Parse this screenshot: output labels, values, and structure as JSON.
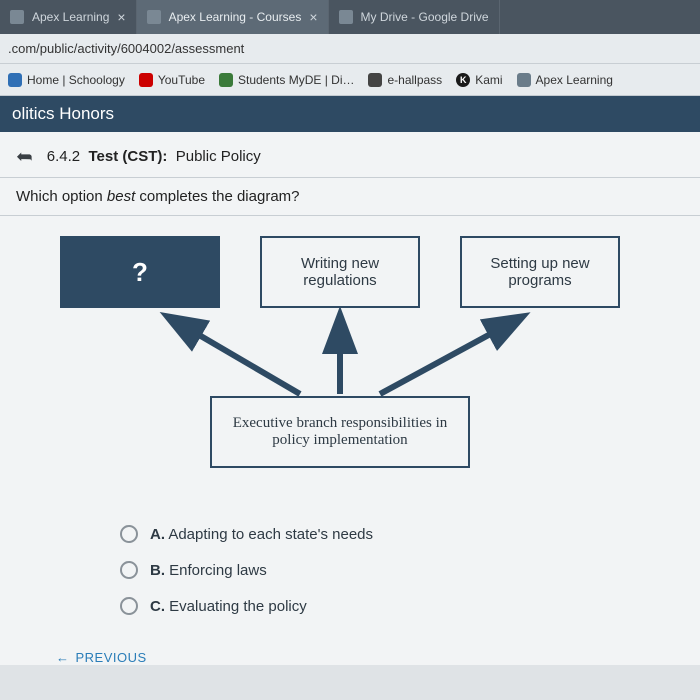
{
  "tabs": {
    "t0": {
      "label": "Apex Learning"
    },
    "t1": {
      "label": "Apex Learning - Courses"
    },
    "t2": {
      "label": "My Drive - Google Drive"
    }
  },
  "url": ".com/public/activity/6004002/assessment",
  "bookmarks": {
    "schoology": "Home | Schoology",
    "youtube": "YouTube",
    "myde": "Students MyDE | Di…",
    "ehall": "e-hallpass",
    "kami": "Kami",
    "kami_icon": "K",
    "apex": "Apex Learning"
  },
  "course": "olitics Honors",
  "test": {
    "num": "6.4.2",
    "label_bold": "Test (CST):",
    "subject": "Public Policy"
  },
  "question": {
    "pre": "Which option ",
    "em": "best",
    "post": " completes the diagram?"
  },
  "diagram": {
    "q": "?",
    "mid": "Writing new regulations",
    "right": "Setting up new programs",
    "bottom": "Executive branch responsibilities in policy implementation"
  },
  "answers": {
    "a": {
      "letter": "A.",
      "text": " Adapting to each state's needs"
    },
    "b": {
      "letter": "B.",
      "text": " Enforcing laws"
    },
    "c": {
      "letter": "C.",
      "text": " Evaluating the policy"
    }
  },
  "prev": "PREVIOUS"
}
